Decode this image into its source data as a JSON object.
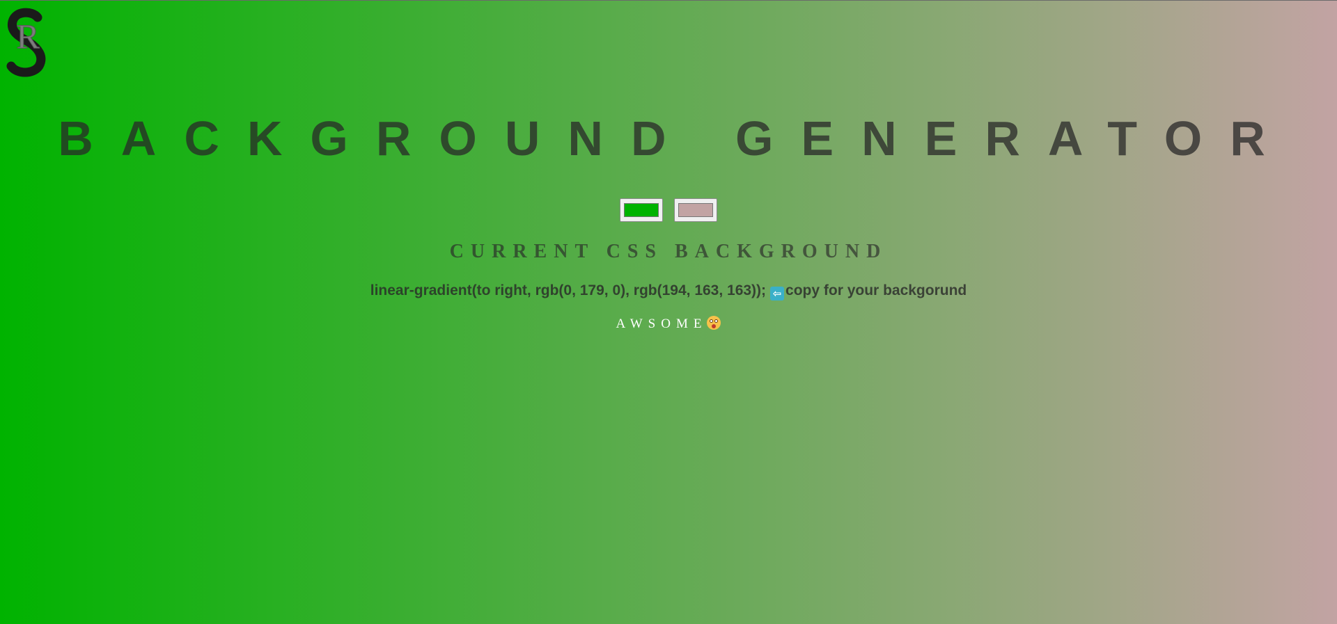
{
  "header": {
    "logo_icon": "sr-logo-icon",
    "logo_text": "R",
    "title": "BACKGROUND GENERATOR"
  },
  "pickers": {
    "color1": "#00b300",
    "color2": "#c2a3a3"
  },
  "background": {
    "gradient": "linear-gradient(to right, rgb(0, 179, 0), rgb(194, 163, 163))"
  },
  "output": {
    "subtitle": "CURRENT CSS BACKGROUND",
    "css_text": "linear-gradient(to right, rgb(0, 179, 0), rgb(194, 163, 163));",
    "arrow_icon": "left-arrow-icon",
    "copy_hint": "copy for your backgorund"
  },
  "footer": {
    "awsome_text": "AWSOME",
    "face_icon": "astonished-face-icon"
  }
}
